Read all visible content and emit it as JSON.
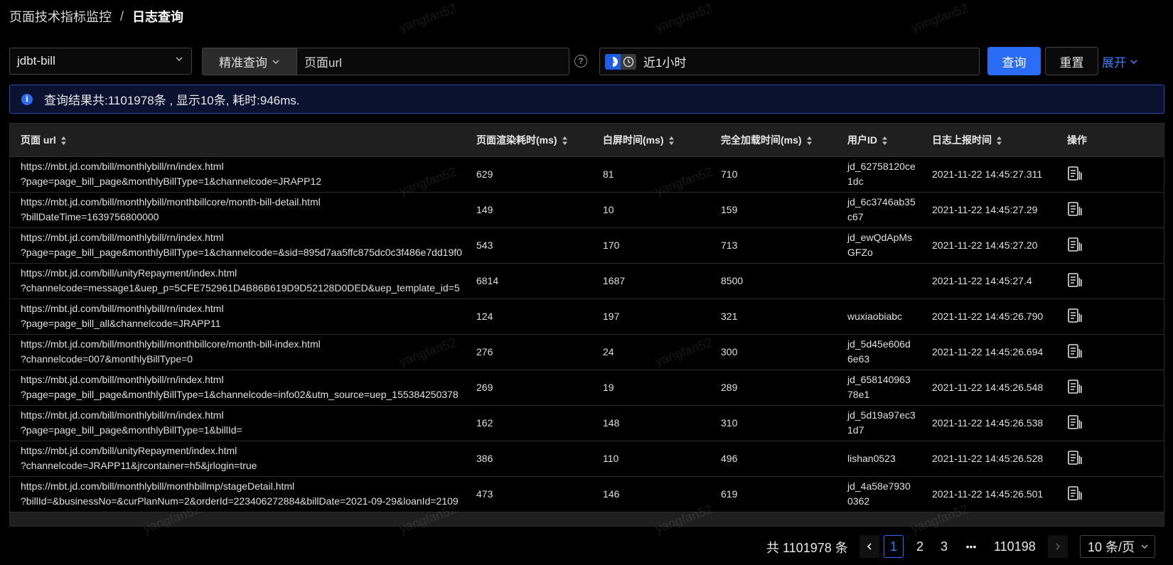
{
  "breadcrumb": {
    "parent": "页面技术指标监控",
    "separator": "/",
    "current": "日志查询"
  },
  "filters": {
    "app_select": "jdbt-bill",
    "query_mode": "精准查询",
    "query_field": "页面url",
    "help_icon": "question-circle-icon",
    "time_range": "近1小时",
    "search_button": "查询",
    "reset_button": "重置",
    "expand_button": "展开"
  },
  "alert": {
    "message": "查询结果共:1101978条 , 显示10条, 耗时:946ms."
  },
  "table": {
    "columns": [
      "页面 url",
      "页面渲染耗时(ms)",
      "白屏时间(ms)",
      "完全加载时间(ms)",
      "用户ID",
      "日志上报时间",
      "操作"
    ],
    "rows": [
      {
        "url1": "https://mbt.jd.com/bill/monthlybill/rn/index.html",
        "url2": "?page=page_bill_page&monthlyBillType=1&channelcode=JRAPP12",
        "render": "629",
        "white": "81",
        "full": "710",
        "uid": "jd_62758120ce1dc",
        "time": "2021-11-22 14:45:27.311"
      },
      {
        "url1": "https://mbt.jd.com/bill/monthlybill/monthbillcore/month-bill-detail.html",
        "url2": "?billDateTime=1639756800000",
        "render": "149",
        "white": "10",
        "full": "159",
        "uid": "jd_6c3746ab35c67",
        "time": "2021-11-22 14:45:27.29"
      },
      {
        "url1": "https://mbt.jd.com/bill/monthlybill/rn/index.html",
        "url2": "?page=page_bill_page&monthlyBillType=1&channelcode=&sid=895d7aa5ffc875dc0c3f486e7dd19f0",
        "render": "543",
        "white": "170",
        "full": "713",
        "uid": "jd_ewQdApMsGFZo",
        "time": "2021-11-22 14:45:27.20"
      },
      {
        "url1": "https://mbt.jd.com/bill/unityRepayment/index.html",
        "url2": "?channelcode=message1&uep_p=5CFE752961D4B86B619D9D52128D0DED&uep_template_id=5",
        "render": "6814",
        "white": "1687",
        "full": "8500",
        "uid": "",
        "time": "2021-11-22 14:45:27.4"
      },
      {
        "url1": "https://mbt.jd.com/bill/monthlybill/rn/index.html",
        "url2": "?page=page_bill_all&channelcode=JRAPP11",
        "render": "124",
        "white": "197",
        "full": "321",
        "uid": "wuxiaobiabc",
        "time": "2021-11-22 14:45:26.790"
      },
      {
        "url1": "https://mbt.jd.com/bill/monthlybill/monthbillcore/month-bill-index.html",
        "url2": "?channelcode=007&monthlyBillType=0",
        "render": "276",
        "white": "24",
        "full": "300",
        "uid": "jd_5d45e606d6e63",
        "time": "2021-11-22 14:45:26.694"
      },
      {
        "url1": "https://mbt.jd.com/bill/monthlybill/rn/index.html",
        "url2": "?page=page_bill_page&monthlyBillType=1&channelcode=info02&utm_source=uep_155384250378",
        "render": "269",
        "white": "19",
        "full": "289",
        "uid": "jd_65814096378e1",
        "time": "2021-11-22 14:45:26.548"
      },
      {
        "url1": "https://mbt.jd.com/bill/monthlybill/rn/index.html",
        "url2": "?page=page_bill_page&monthlyBillType=1&billId=",
        "render": "162",
        "white": "148",
        "full": "310",
        "uid": "jd_5d19a97ec31d7",
        "time": "2021-11-22 14:45:26.538"
      },
      {
        "url1": "https://mbt.jd.com/bill/unityRepayment/index.html",
        "url2": "?channelcode=JRAPP11&jrcontainer=h5&jrlogin=true",
        "render": "386",
        "white": "110",
        "full": "496",
        "uid": "lishan0523",
        "time": "2021-11-22 14:45:26.528"
      },
      {
        "url1": "https://mbt.jd.com/bill/monthlybill/monthbillmp/stageDetail.html",
        "url2": "?billId=&businessNo=&curPlanNum=2&orderId=223406272884&billDate=2021-09-29&loanId=2109",
        "render": "473",
        "white": "146",
        "full": "619",
        "uid": "jd_4a58e79300362",
        "time": "2021-11-22 14:45:26.501"
      }
    ]
  },
  "pagination": {
    "total": "共 1101978 条",
    "pages": [
      "1",
      "2",
      "3"
    ],
    "current_page": "1",
    "ellipsis": "•••",
    "last_page": "110198",
    "page_size": "10 条/页"
  },
  "watermark": "yangfan52",
  "colors": {
    "accent": "#2a6cf5",
    "link": "#3b7bf7",
    "background": "#000000",
    "header_bg": "#1f1f1f"
  }
}
